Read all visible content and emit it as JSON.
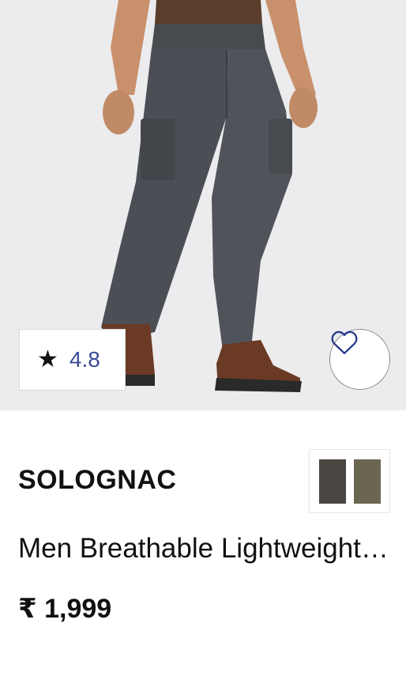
{
  "product": {
    "image_description_icon": "pants-product-image",
    "rating": {
      "icon": "star-icon",
      "star_glyph": "★",
      "value": "4.8"
    },
    "wishlist": {
      "icon": "heart-outline-icon"
    },
    "brand": "SOLOGNAC",
    "title": "Men Breathable Lightweight Trekking Pants",
    "price": "₹ 1,999",
    "colors": [
      "#4a4742",
      "#6a6650"
    ],
    "accent_color": "#3a4a94"
  }
}
